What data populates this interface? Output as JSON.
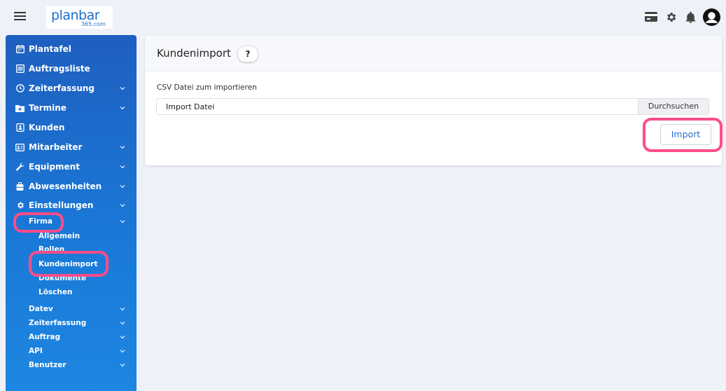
{
  "app": {
    "logo_main": "planbar",
    "logo_sub": "365.com",
    "icons": [
      "menu-icon",
      "credit-card-icon",
      "gear-icon",
      "bell-icon",
      "account-circle-icon"
    ]
  },
  "sidebar": {
    "items": [
      {
        "label": "Plantafel",
        "icon": "calendar-icon"
      },
      {
        "label": "Auftragsliste",
        "icon": "list-icon"
      },
      {
        "label": "Zeiterfassung",
        "icon": "clock-icon"
      },
      {
        "label": "Termine",
        "icon": "calendar-plus-icon"
      },
      {
        "label": "Kunden",
        "icon": "contact-icon"
      },
      {
        "label": "Mitarbeiter",
        "icon": "id-card-icon"
      },
      {
        "label": "Equipment",
        "icon": "wrench-icon"
      },
      {
        "label": "Abwesenheiten",
        "icon": "suitcase-icon"
      },
      {
        "label": "Einstellungen",
        "icon": "gear-icon"
      }
    ],
    "firma": {
      "label": "Firma",
      "children": [
        "Allgemein",
        "Rollen",
        "Kundenimport",
        "Dokumente",
        "Löschen"
      ]
    },
    "more": [
      "Datev",
      "Zeiterfassung",
      "Auftrag",
      "API",
      "Benutzer"
    ]
  },
  "main": {
    "title": "Kundenimport",
    "help_label": "?",
    "field_label": "CSV Datei zum importieren",
    "file_placeholder": "Import Datei",
    "browse_label": "Durchsuchen",
    "import_label": "Import"
  },
  "colors": {
    "sidebar_top": "#1e5fc0",
    "sidebar_bottom": "#1d86e0",
    "accent": "#2d6fd1",
    "highlight": "#ff4d88",
    "background": "#eef1f8"
  }
}
